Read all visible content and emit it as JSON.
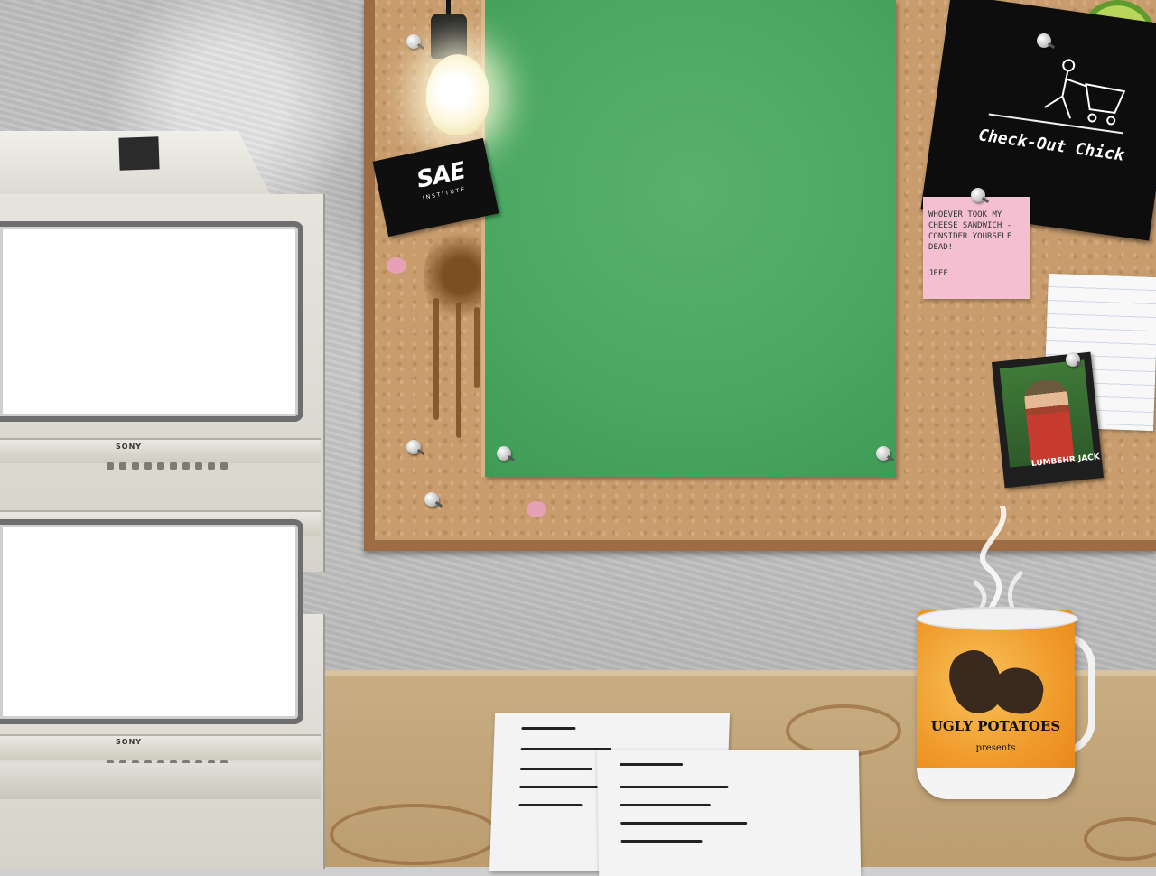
{
  "scene": {
    "title": "",
    "colors": {
      "board_green": "#4aa861",
      "cork": "#c89c6c",
      "mug_orange": "#f09a2a",
      "sticky_pink": "#f3bfd1"
    }
  },
  "monitors": {
    "brand_top": "SONY",
    "brand_bottom": "SONY"
  },
  "corkboard": {
    "sae_card": {
      "logo": "SAE",
      "subtitle": "INSTITUTE"
    },
    "poster": {
      "title": "Check-Out Chick"
    },
    "sticky_note": {
      "text": "WHOEVER TOOK MY CHEESE SANDWICH - CONSIDER YOURSELF DEAD!",
      "signature": "JEFF"
    },
    "photo": {
      "caption": "LUMBEHR JACK"
    }
  },
  "mug": {
    "brand": "UGLY POTATOES",
    "tagline": "presents"
  },
  "icons": {
    "bulb": "light-bulb-icon",
    "pin": "push-pin-icon",
    "lime": "lime-slice-icon",
    "steam": "steam-icon"
  }
}
